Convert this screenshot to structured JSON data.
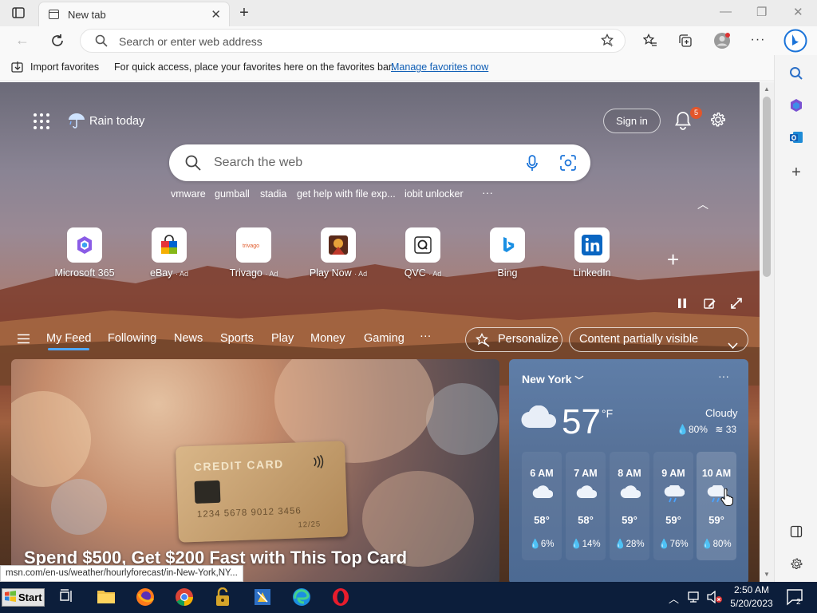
{
  "browser": {
    "tab_title": "New tab",
    "address_placeholder": "Search or enter web address"
  },
  "favorites_bar": {
    "import_label": "Import favorites",
    "message": "For quick access, place your favorites here on the favorites bar.",
    "manage_link": "Manage favorites now"
  },
  "top": {
    "weather_summary": "Rain today",
    "sign_in": "Sign in",
    "notification_count": "5"
  },
  "search": {
    "placeholder": "Search the web",
    "trending": [
      "vmware",
      "gumball",
      "stadia",
      "get help with file exp...",
      "iobit unlocker"
    ],
    "more": "···"
  },
  "quick_links": [
    {
      "label": "Microsoft 365",
      "ad": "",
      "icon": "microsoft-365-icon"
    },
    {
      "label": "eBay",
      "ad": "· Ad",
      "icon": "ebay-icon"
    },
    {
      "label": "Trivago",
      "ad": "· Ad",
      "icon": "trivago-icon"
    },
    {
      "label": "Play Now",
      "ad": "· Ad",
      "icon": "play-now-icon"
    },
    {
      "label": "QVC",
      "ad": "· Ad",
      "icon": "qvc-icon"
    },
    {
      "label": "Bing",
      "ad": "",
      "icon": "bing-icon"
    },
    {
      "label": "LinkedIn",
      "ad": "",
      "icon": "linkedin-icon"
    }
  ],
  "feed_nav": {
    "items": [
      "My Feed",
      "Following",
      "News",
      "Sports",
      "Play",
      "Money",
      "Gaming"
    ],
    "more": "···",
    "personalize": "Personalize",
    "content_visibility": "Content partially visible"
  },
  "hero_card": {
    "card_text": "CREDIT CARD",
    "card_number": "1234 5678 9012 3456",
    "card_expiry": "12/25",
    "headline": "Spend $500, Get $200 Fast with This Top Card"
  },
  "weather": {
    "city": "New York",
    "temp": "57",
    "unit": "°F",
    "condition": "Cloudy",
    "humidity": "80%",
    "wind": "33",
    "hourly": [
      {
        "time": "6 AM",
        "temp": "58°",
        "precip": "6%",
        "icon": "cloudy-icon"
      },
      {
        "time": "7 AM",
        "temp": "58°",
        "precip": "14%",
        "icon": "cloudy-icon"
      },
      {
        "time": "8 AM",
        "temp": "59°",
        "precip": "28%",
        "icon": "cloudy-icon"
      },
      {
        "time": "9 AM",
        "temp": "59°",
        "precip": "76%",
        "icon": "rain-icon"
      },
      {
        "time": "10 AM",
        "temp": "59°",
        "precip": "80%",
        "icon": "rain-icon"
      }
    ]
  },
  "status_url": "msn.com/en-us/weather/hourlyforecast/in-New-York,NY...",
  "taskbar": {
    "start": "Start",
    "time": "2:50 AM",
    "date": "5/20/2023",
    "notifications": "2"
  },
  "colors": {
    "accent": "#0f5eb5",
    "taskbar": "#0c1e3b",
    "weather_card": "#556f95",
    "badge": "#e2562b"
  }
}
